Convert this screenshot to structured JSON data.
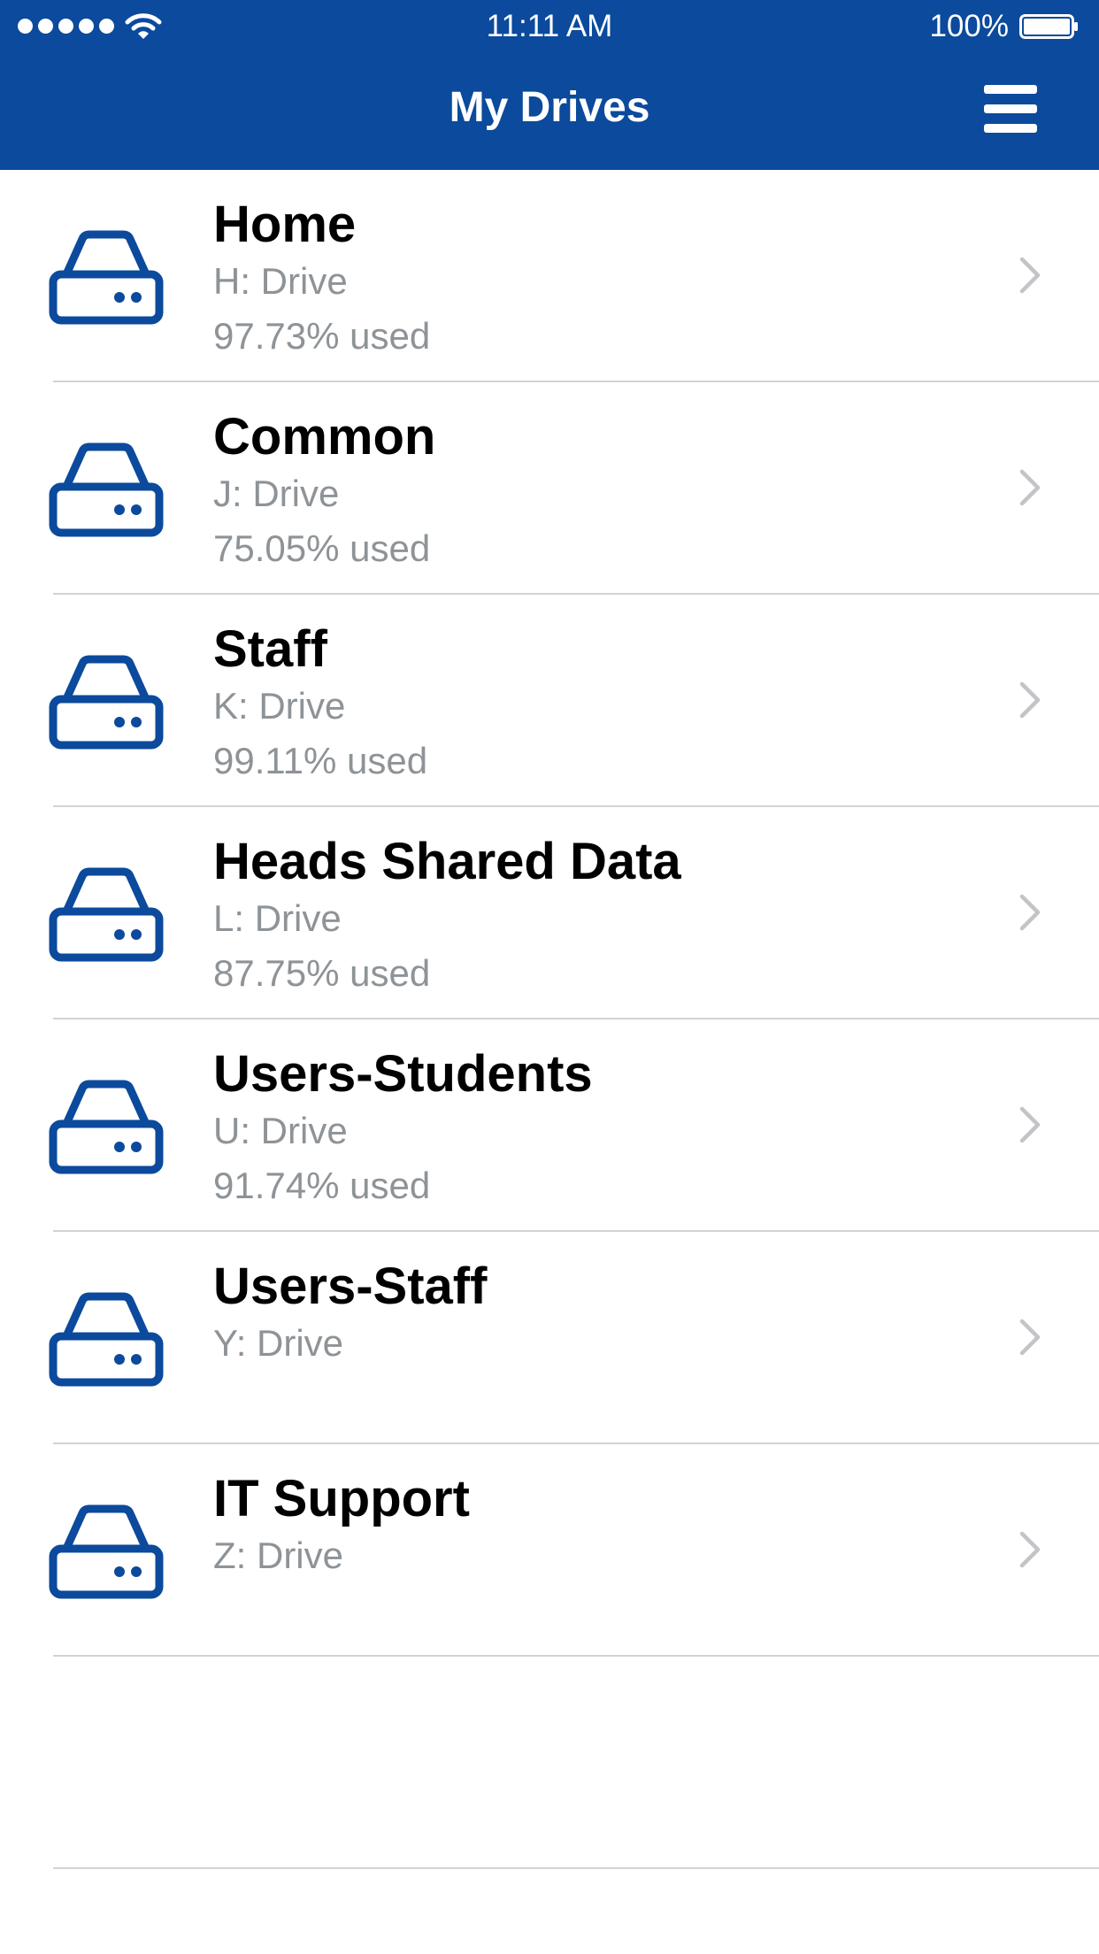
{
  "status_bar": {
    "time": "11:11 AM",
    "battery": "100%",
    "signal_icon": "signal-dots-icon",
    "wifi_icon": "wifi-icon",
    "battery_icon": "battery-icon"
  },
  "nav": {
    "title": "My Drives",
    "menu_icon": "hamburger-menu-icon"
  },
  "colors": {
    "brand": "#0b4a9c",
    "secondary_text": "#8e9397",
    "separator": "#d3d3d6",
    "chevron": "#c4c4c8"
  },
  "drives": [
    {
      "name": "Home",
      "letter": "H: Drive",
      "usage": "97.73% used"
    },
    {
      "name": "Common",
      "letter": "J: Drive",
      "usage": "75.05% used"
    },
    {
      "name": "Staff",
      "letter": "K: Drive",
      "usage": "99.11% used"
    },
    {
      "name": "Heads Shared Data",
      "letter": "L: Drive",
      "usage": "87.75% used"
    },
    {
      "name": "Users-Students",
      "letter": "U: Drive",
      "usage": "91.74% used"
    },
    {
      "name": "Users-Staff",
      "letter": "Y: Drive"
    },
    {
      "name": "IT Support",
      "letter": "Z: Drive"
    }
  ]
}
